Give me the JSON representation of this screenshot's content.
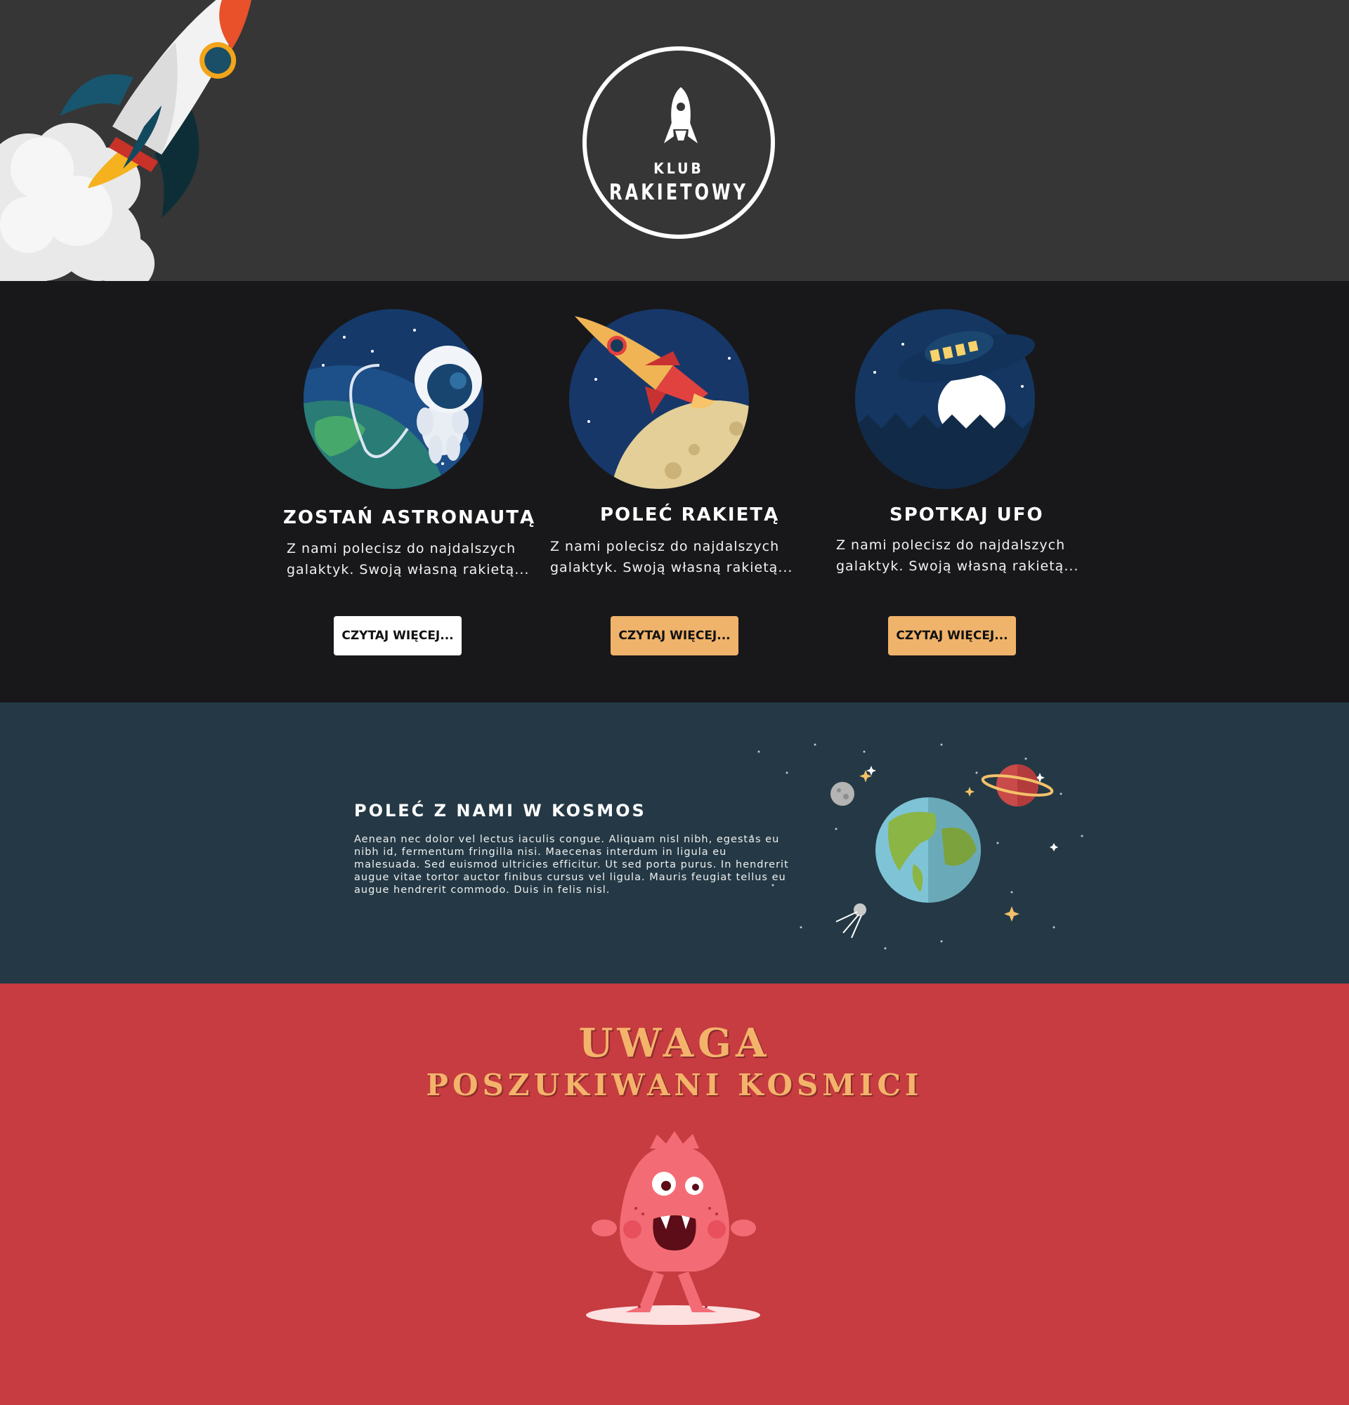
{
  "header": {
    "logo_small": "KLUB",
    "logo_big": "RAKIETOWY"
  },
  "features": [
    {
      "title": "ZOSTAŃ ASTRONAUTĄ",
      "text": "Z nami polecisz do najdalszych galaktyk. Swoją własną rakietą...",
      "button": "CZYTAJ WIĘCEJ...",
      "button_color": "#ffffff",
      "icon": "astronaut-icon"
    },
    {
      "title": "POLEĆ RAKIETĄ",
      "text": "Z nami polecisz do najdalszych galaktyk. Swoją własną rakietą...",
      "button": "CZYTAJ WIĘCEJ...",
      "button_color": "#f0b36b",
      "icon": "rocket-moon-icon"
    },
    {
      "title": "SPOTKAJ UFO",
      "text": "Z nami polecisz do najdalszych galaktyk. Swoją własną rakietą...",
      "button": "CZYTAJ WIĘCEJ...",
      "button_color": "#f0b36b",
      "icon": "ufo-icon"
    }
  ],
  "space": {
    "title": "POLEĆ Z NAMI W KOSMOS",
    "text": "Aenean nec dolor vel lectus iaculis congue. Aliquam nisl nibh, egestas eu nibh id, fermentum fringilla nisi. Maecenas interdum in ligula eu malesuada. Sed euismod ultricies efficitur. Ut sed porta purus. In hendrerit augue vitae tortor auctor finibus cursus vel ligula. Mauris feugiat tellus eu augue hendrerit commodo. Duis in felis nisl."
  },
  "wanted": {
    "title_line1": "UWAGA",
    "title_line2": "POSZUKIWANI KOSMICI"
  },
  "colors": {
    "header_bg": "#363636",
    "features_bg": "#18181a",
    "space_bg": "#243945",
    "wanted_bg": "#c63c40",
    "accent": "#f0b36b"
  }
}
